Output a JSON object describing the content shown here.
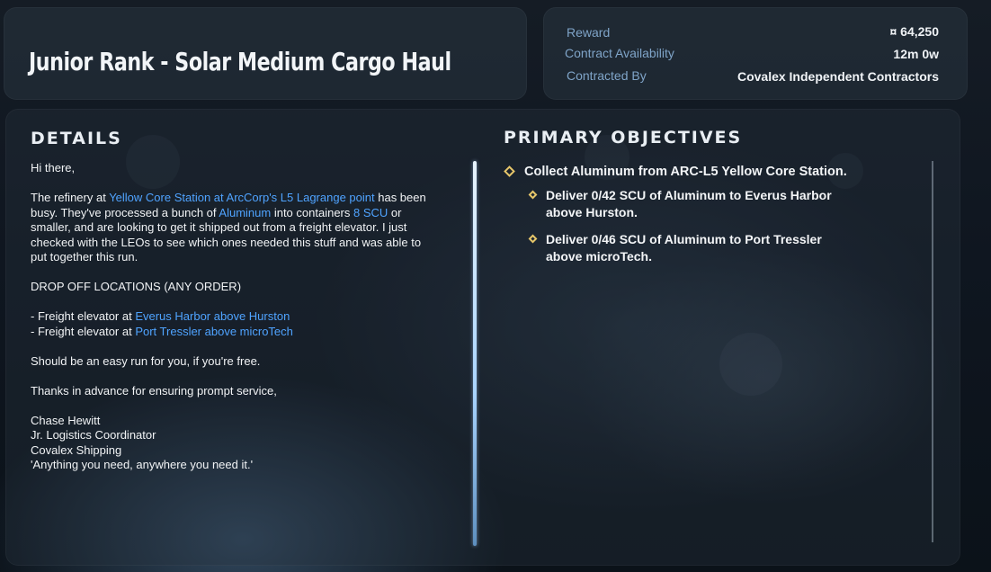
{
  "contract": {
    "title": "Junior Rank - Solar Medium Cargo Haul"
  },
  "info": {
    "reward_label": "Reward",
    "reward_value": "¤ 64,250",
    "availability_label": "Contract Availability",
    "availability_value": "12m 0w",
    "contracted_by_label": "Contracted By",
    "contracted_by_value": "Covalex Independent Contractors"
  },
  "details": {
    "heading": "DETAILS",
    "greeting": "Hi there,",
    "p1_a": "The refinery at ",
    "p1_link1": "Yellow Core Station at ArcCorp's L5 Lagrange point",
    "p1_b": " has been busy. They've processed a bunch of ",
    "p1_link2": "Aluminum",
    "p1_c": " into containers ",
    "p1_link3": "8 SCU",
    "p1_d": " or smaller, and are looking to get it shipped out from a freight elevator. I just checked with the LEOs to see which ones needed this stuff and was able to put together this run.",
    "dropoff_heading": "DROP OFF LOCATIONS (ANY ORDER)",
    "dropoff1_prefix": "- Freight elevator at ",
    "dropoff1_link": "Everus Harbor above Hurston",
    "dropoff2_prefix": "- Freight elevator at ",
    "dropoff2_link": "Port Tressler above microTech",
    "easy_run": "Should be an easy run for you, if you're free.",
    "thanks": "Thanks in advance for ensuring prompt service,",
    "sig_name": "Chase Hewitt",
    "sig_title": "Jr. Logistics Coordinator",
    "sig_company": "Covalex Shipping",
    "sig_motto": "'Anything you need, anywhere you need it.'"
  },
  "objectives": {
    "heading": "PRIMARY OBJECTIVES",
    "main": "Collect Aluminum from ARC-L5 Yellow Core Station.",
    "sub1_line1": "Deliver 0/42 SCU of Aluminum to Everus Harbor",
    "sub1_line2": "above Hurston.",
    "sub2_line1": "Deliver 0/46 SCU of Aluminum to Port Tressler",
    "sub2_line2": "above microTech."
  },
  "colors": {
    "link": "#4fa3ff",
    "objective_marker": "#e6c66a",
    "info_label": "#7fa4c8"
  }
}
